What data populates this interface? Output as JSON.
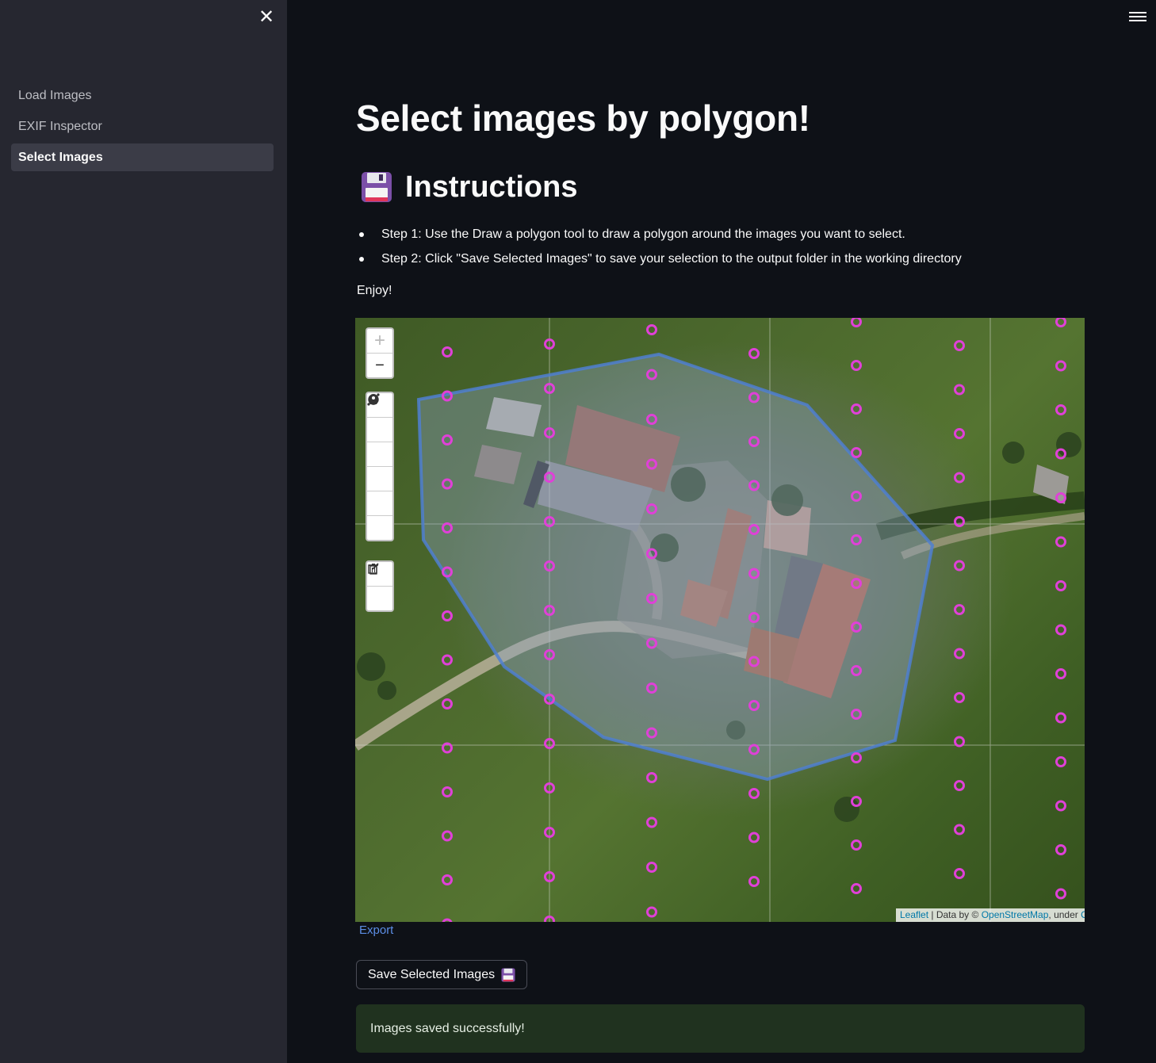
{
  "sidebar": {
    "items": [
      {
        "label": "Load Images",
        "active": false
      },
      {
        "label": "EXIF Inspector",
        "active": false
      },
      {
        "label": "Select Images",
        "active": true
      }
    ]
  },
  "main": {
    "title": "Select images by polygon!",
    "instructions_heading": "Instructions",
    "instructions_icon": "floppy-disk-icon",
    "steps": [
      "Step 1: Use the Draw a polygon tool to draw a polygon around the images you want to select.",
      "Step 2: Click \"Save Selected Images\" to save your selection to the output folder in the working directory"
    ],
    "enjoy": "Enjoy!",
    "export_label": "Export",
    "save_button_label": "Save Selected Images",
    "success_message": "Images saved successfully!"
  },
  "map": {
    "attribution": {
      "leaflet": "Leaflet",
      "separator": " | Data by © ",
      "osm": "OpenStreetMap",
      "under": ", under ",
      "license_fragment": "O"
    },
    "zoom_in_symbol": "+",
    "zoom_out_symbol": "−",
    "draw_tools": [
      "polyline",
      "polygon",
      "rectangle",
      "circle",
      "marker",
      "circlemarker"
    ],
    "edit_tools": [
      "edit",
      "delete"
    ],
    "colors": {
      "markers": "#e040d8",
      "polygon_stroke": "#4f7fd0",
      "polygon_fill": "#7f9ac0"
    }
  }
}
